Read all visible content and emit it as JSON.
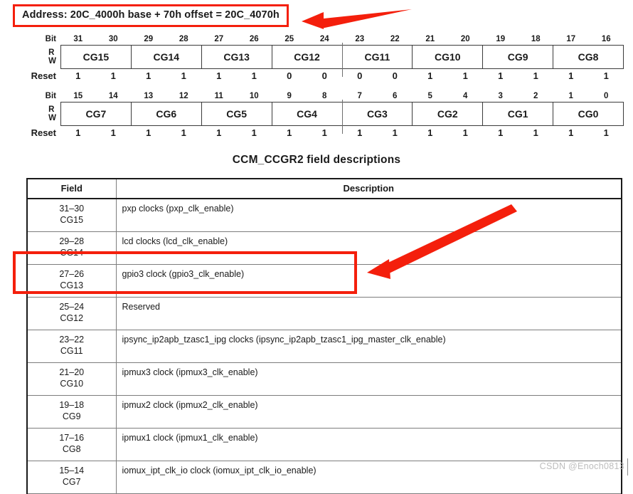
{
  "address_note": {
    "text": "Address: 20C_4000h base + 70h offset = 20C_4070h"
  },
  "register_diagram": {
    "labels": {
      "bit": "Bit",
      "r": "R",
      "w": "W",
      "reset": "Reset"
    },
    "rows": [
      {
        "bit_numbers": [
          "31",
          "30",
          "29",
          "28",
          "27",
          "26",
          "25",
          "24",
          "23",
          "22",
          "21",
          "20",
          "19",
          "18",
          "17",
          "16"
        ],
        "fields": [
          "CG15",
          "CG14",
          "CG13",
          "CG12",
          "CG11",
          "CG10",
          "CG9",
          "CG8"
        ],
        "reset": [
          "1",
          "1",
          "1",
          "1",
          "1",
          "1",
          "0",
          "0",
          "0",
          "0",
          "1",
          "1",
          "1",
          "1",
          "1",
          "1"
        ]
      },
      {
        "bit_numbers": [
          "15",
          "14",
          "13",
          "12",
          "11",
          "10",
          "9",
          "8",
          "7",
          "6",
          "5",
          "4",
          "3",
          "2",
          "1",
          "0"
        ],
        "fields": [
          "CG7",
          "CG6",
          "CG5",
          "CG4",
          "CG3",
          "CG2",
          "CG1",
          "CG0"
        ],
        "reset": [
          "1",
          "1",
          "1",
          "1",
          "1",
          "1",
          "1",
          "1",
          "1",
          "1",
          "1",
          "1",
          "1",
          "1",
          "1",
          "1"
        ]
      }
    ]
  },
  "section_title": "CCM_CCGR2 field descriptions",
  "field_table": {
    "headers": {
      "field": "Field",
      "description": "Description"
    },
    "rows": [
      {
        "bits": "31–30",
        "cg": "CG15",
        "description": "pxp clocks (pxp_clk_enable)"
      },
      {
        "bits": "29–28",
        "cg": "CG14",
        "description": "lcd clocks (lcd_clk_enable)"
      },
      {
        "bits": "27–26",
        "cg": "CG13",
        "description": "gpio3 clock (gpio3_clk_enable)"
      },
      {
        "bits": "25–24",
        "cg": "CG12",
        "description": "Reserved"
      },
      {
        "bits": "23–22",
        "cg": "CG11",
        "description": "ipsync_ip2apb_tzasc1_ipg clocks (ipsync_ip2apb_tzasc1_ipg_master_clk_enable)"
      },
      {
        "bits": "21–20",
        "cg": "CG10",
        "description": "ipmux3 clock (ipmux3_clk_enable)"
      },
      {
        "bits": "19–18",
        "cg": "CG9",
        "description": "ipmux2 clock (ipmux2_clk_enable)"
      },
      {
        "bits": "17–16",
        "cg": "CG8",
        "description": "ipmux1 clock (ipmux1_clk_enable)"
      },
      {
        "bits": "15–14",
        "cg": "CG7",
        "description": "iomux_ipt_clk_io clock (iomux_ipt_clk_io_enable)"
      }
    ]
  },
  "annotations": {
    "highlight_color": "#f41f0c",
    "arrow_color": "#f41f0c",
    "items": [
      {
        "name": "address-highlight-box"
      },
      {
        "name": "cg13-row-highlight-box"
      },
      {
        "name": "arrow-to-address"
      },
      {
        "name": "arrow-to-cg13-row"
      }
    ]
  },
  "watermark": {
    "text": "CSDN @Enoch0813"
  }
}
